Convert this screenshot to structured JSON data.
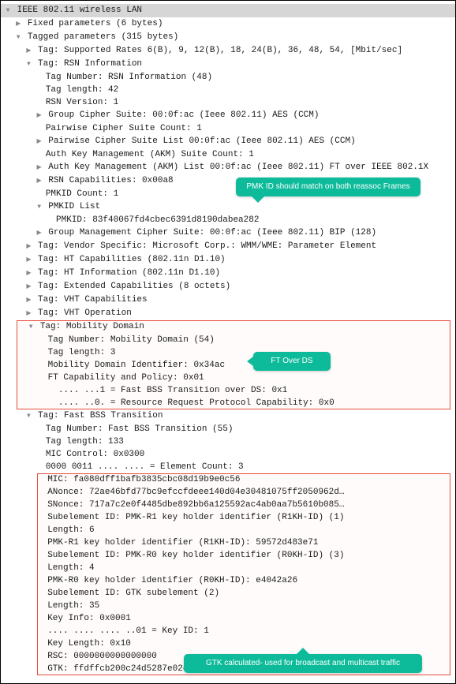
{
  "header": "IEEE 802.11 wireless LAN",
  "fixed": "Fixed parameters (6 bytes)",
  "tagged": "Tagged parameters (315 bytes)",
  "supported": "Tag: Supported Rates 6(B), 9, 12(B), 18, 24(B), 36, 48, 54, [Mbit/sec]",
  "rsn": {
    "title": "Tag: RSN Information",
    "number": "Tag Number: RSN Information (48)",
    "length": "Tag length: 42",
    "version": "RSN Version: 1",
    "gcs": "Group Cipher Suite: 00:0f:ac (Ieee 802.11) AES (CCM)",
    "pcsc": "Pairwise Cipher Suite Count: 1",
    "pcs": "Pairwise Cipher Suite List 00:0f:ac (Ieee 802.11) AES (CCM)",
    "akmc": "Auth Key Management (AKM) Suite Count: 1",
    "akm": "Auth Key Management (AKM) List 00:0f:ac (Ieee 802.11) FT over IEEE 802.1X",
    "caps": "RSN Capabilities: 0x00a8",
    "pmkidc": "PMKID Count: 1",
    "pmkidl": "PMKID List",
    "pmkid": "PMKID: 83f40067fd4cbec6391d8190dabea282",
    "gmcs": "Group Management Cipher Suite: 00:0f:ac (Ieee 802.11) BIP (128)"
  },
  "vendor": "Tag: Vendor Specific: Microsoft Corp.: WMM/WME: Parameter Element",
  "htcap": "Tag: HT Capabilities (802.11n D1.10)",
  "htinfo": "Tag: HT Information (802.11n D1.10)",
  "ext": "Tag: Extended Capabilities (8 octets)",
  "vhtcap": "Tag: VHT Capabilities",
  "vhtop": "Tag: VHT Operation",
  "mobility": {
    "title": "Tag: Mobility Domain",
    "number": "Tag Number: Mobility Domain (54)",
    "length": "Tag length: 3",
    "mdid": "Mobility Domain Identifier: 0x34ac",
    "cap": "FT Capability and Policy: 0x01",
    "b1": ".... ...1 = Fast BSS Transition over DS: 0x1",
    "b2": ".... ..0. = Resource Request Protocol Capability: 0x0"
  },
  "fbt": {
    "title": "Tag: Fast BSS Transition",
    "number": "Tag Number: Fast BSS Transition (55)",
    "length": "Tag length: 133",
    "micc": "MIC Control: 0x0300",
    "elc": "0000 0011 .... .... = Element Count: 3",
    "mic": "MIC: fa080dff1bafb3835cbc08d19b9e0c56",
    "anonce": "ANonce: 72ae46bfd77bc9efccfdeee140d04e30481075ff2050962d…",
    "snonce": "SNonce: 717a7c2e0f4485dbe892bb6a125592ac4ab0aa7b5610b085…",
    "sub1": "Subelement ID: PMK-R1 key holder identifier (R1KH-ID) (1)",
    "len1": "Length: 6",
    "r1kh": "PMK-R1 key holder identifier (R1KH-ID): 59572d483e71",
    "sub2": "Subelement ID: PMK-R0 key holder identifier (R0KH-ID) (3)",
    "len2": "Length: 4",
    "r0kh": "PMK-R0 key holder identifier (R0KH-ID): e4042a26",
    "sub3": "Subelement ID: GTK subelement (2)",
    "len3": "Length: 35",
    "keyi": "Key Info: 0x0001",
    "keyid": ".... .... .... ..01 = Key ID: 1",
    "keyl": "Key Length: 0x10",
    "rsc": "RSC: 0000000000000000",
    "gtk": "GTK: ffdffcb200c24d5287e02ceaf8418e0bb654829f1d2cff86"
  },
  "annot": {
    "pmk": "PMK ID should match on both reassoc Frames",
    "ft": "FT Over DS",
    "gtk": "GTK calculated- used for broadcast and multicast traffic"
  }
}
